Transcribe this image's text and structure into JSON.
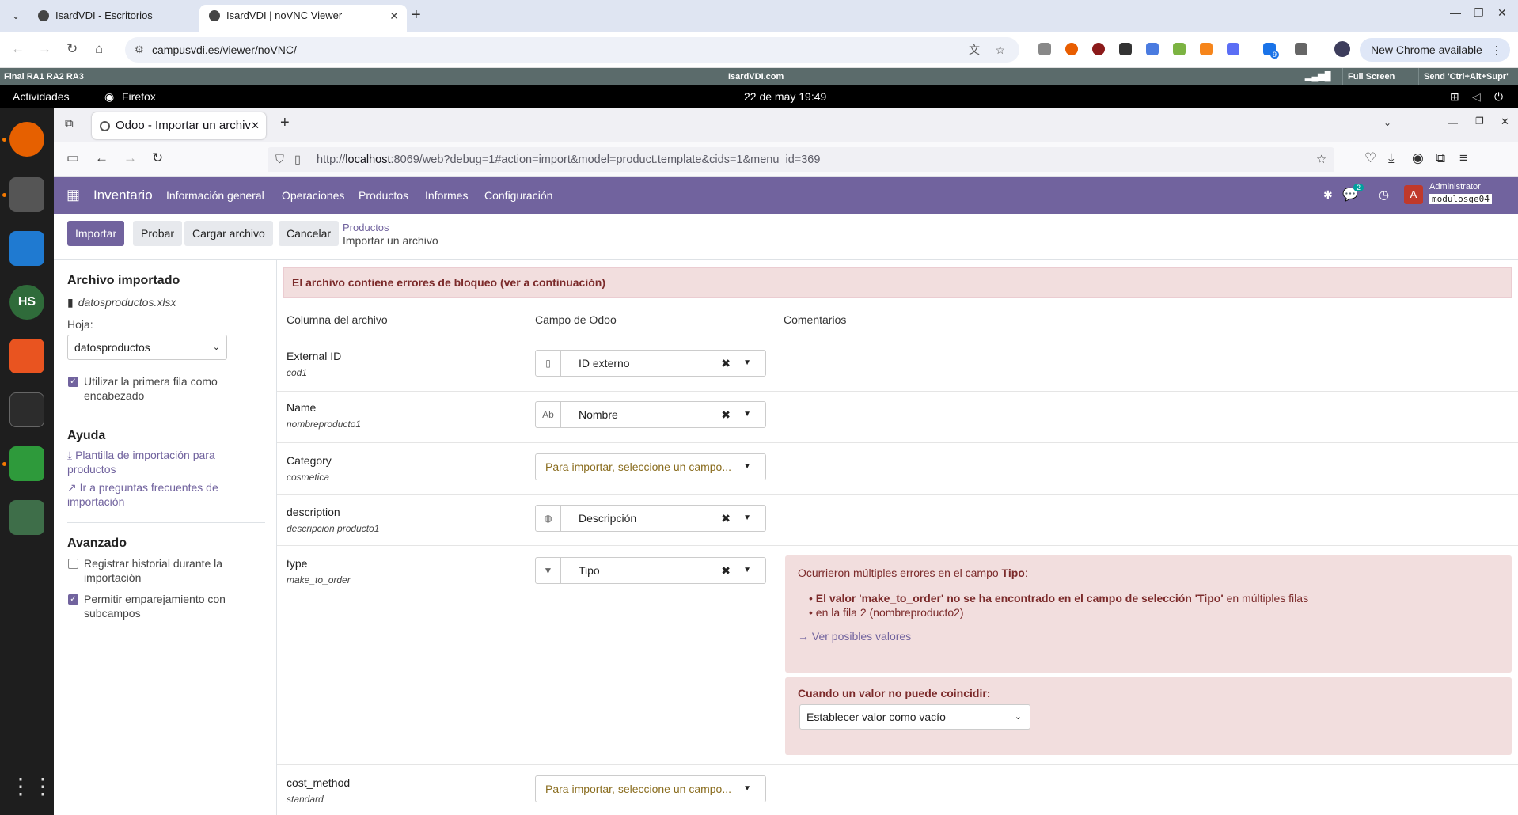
{
  "browser": {
    "tabs": [
      {
        "title": "IsardVDI - Escritorios"
      },
      {
        "title": "IsardVDI | noVNC Viewer"
      }
    ],
    "url": "campusvdi.es/viewer/noVNC/",
    "new_chrome_label": "New Chrome available",
    "ext_badge": "9"
  },
  "novnc": {
    "left_label": "Final RA1 RA2 RA3",
    "center_label": "IsardVDI.com",
    "fullscreen_label": "Full Screen",
    "send_keys_label": "Send 'Ctrl+Alt+Supr'"
  },
  "gnome": {
    "activities": "Actividades",
    "app_name": "Firefox",
    "clock": "22 de may  19:49"
  },
  "firefox": {
    "tab_title": "Odoo - Importar un archiv",
    "url_prefix": "http://",
    "url_host": "localhost",
    "url_rest": ":8069/web?debug=1#action=import&model=product.template&cids=1&menu_id=369"
  },
  "odoo": {
    "app_name": "Inventario",
    "menus": [
      "Información general",
      "Operaciones",
      "Productos",
      "Informes",
      "Configuración"
    ],
    "chat_badge": "2",
    "avatar_letter": "A",
    "user_name": "Administrator",
    "db_name": "modulosge04",
    "buttons": {
      "import": "Importar",
      "test": "Probar",
      "load": "Cargar archivo",
      "cancel": "Cancelar"
    },
    "breadcrumb": {
      "parent": "Productos",
      "current": "Importar un archivo"
    }
  },
  "sidebar": {
    "imported_title": "Archivo importado",
    "filename": "datosproductos.xlsx",
    "sheet_label": "Hoja:",
    "sheet_value": "datosproductos",
    "first_row_header": "Utilizar la primera fila como encabezado",
    "help_title": "Ayuda",
    "template_link": "Plantilla de importación para productos",
    "faq_link": "Ir a preguntas frecuentes de importación",
    "advanced_title": "Avanzado",
    "history_label": "Registrar historial durante la importación",
    "subfields_label": "Permitir emparejamiento con subcampos"
  },
  "main": {
    "alert": "El archivo contiene errores de bloqueo (ver a continuación)",
    "headers": {
      "file_col": "Columna del archivo",
      "odoo_field": "Campo de Odoo",
      "comments": "Comentarios"
    },
    "rows": [
      {
        "name": "External ID",
        "sample": "cod1",
        "field": "ID externo",
        "icon": "document-icon"
      },
      {
        "name": "Name",
        "sample": "nombreproducto1",
        "field": "Nombre",
        "icon": "text-icon"
      },
      {
        "name": "Category",
        "sample": "cosmetica",
        "field": "Para importar, seleccione un campo...",
        "icon": ""
      },
      {
        "name": "description",
        "sample": "descripcion producto1",
        "field": "Descripción",
        "icon": "globe-icon"
      },
      {
        "name": "type",
        "sample": "make_to_order",
        "field": "Tipo",
        "icon": "selection-icon"
      },
      {
        "name": "cost_method",
        "sample": "standard",
        "field": "Para importar, seleccione un campo...",
        "icon": ""
      }
    ],
    "error": {
      "intro": "Ocurrieron múltiples errores en el campo ",
      "field": "Tipo",
      "colon": ":",
      "item1_bold": "El valor 'make_to_order' no se ha encontrado en el campo de selección 'Tipo'",
      "item1_rest": " en múltiples filas",
      "item2": "en la fila 2 (nombreproducto2)",
      "see_values": "Ver posibles valores",
      "no_match_label": "Cuando un valor no puede coincidir:",
      "no_match_value": "Establecer valor como vacío"
    }
  }
}
